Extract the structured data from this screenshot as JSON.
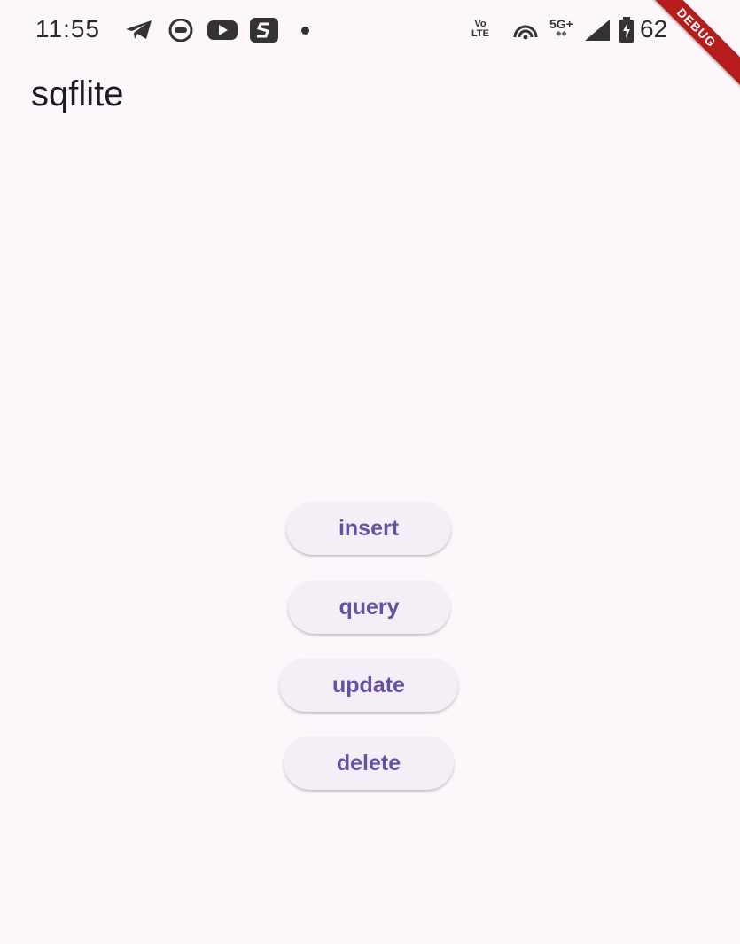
{
  "status_bar": {
    "time": "11:55",
    "notification_icons": [
      "telegram-icon",
      "bot-icon",
      "youtube-icon",
      "app-s-icon"
    ],
    "volte_top": "Vo",
    "volte_bottom": "LTE",
    "network": "5G+",
    "battery": "62"
  },
  "app_bar": {
    "title": "sqflite"
  },
  "debug_banner": "DEBUG",
  "buttons": {
    "insert": "insert",
    "query": "query",
    "update": "update",
    "delete": "delete"
  },
  "colors": {
    "background": "#fdf7fb",
    "button_bg": "#f4eff6",
    "accent": "#6750a4",
    "debug": "#b71c1c"
  }
}
